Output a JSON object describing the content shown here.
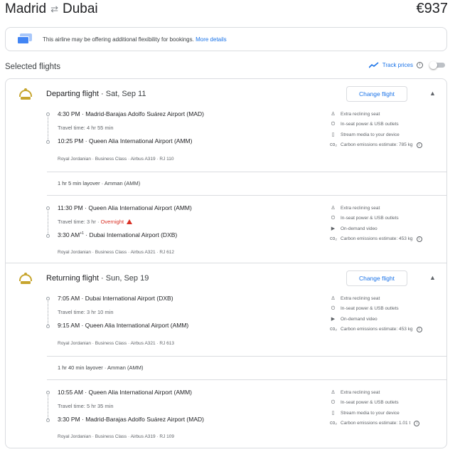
{
  "header": {
    "origin": "Madrid",
    "destination": "Dubai",
    "swap_icon": "swap-arrows-icon",
    "price": "€937"
  },
  "notice": {
    "text": "This airline may be offering additional flexibility for bookings.",
    "link": "More details"
  },
  "selected": {
    "title": "Selected flights",
    "track_label": "Track prices",
    "track_enabled": false
  },
  "departing": {
    "title": "Departing flight",
    "date": "Sat, Sep 11",
    "change_label": "Change flight",
    "seg1": {
      "dep_time": "4:30 PM",
      "dep_airport": "Madrid-Barajas Adolfo Suárez Airport (MAD)",
      "travel_time": "Travel time: 4 hr 55 min",
      "arr_time": "10:25 PM",
      "arr_airport": "Queen Alia International Airport (AMM)",
      "meta": "Royal Jordanian · Business Class · Airbus A319 · RJ 110",
      "amenities": [
        "Extra reclining seat",
        "In-seat power & USB outlets",
        "Stream media to your device",
        "Carbon emissions estimate: 785 kg"
      ]
    },
    "layover": "1 hr 5 min layover · Amman (AMM)",
    "seg2": {
      "dep_time": "11:30 PM",
      "dep_airport": "Queen Alia International Airport (AMM)",
      "travel_time": "Travel time: 3 hr",
      "overnight": "Overnight",
      "arr_time": "3:30 AM",
      "arr_sup": "+1",
      "arr_airport": "Dubai International Airport (DXB)",
      "meta": "Royal Jordanian · Business Class · Airbus A321 · RJ 612",
      "amenities": [
        "Extra reclining seat",
        "In-seat power & USB outlets",
        "On-demand video",
        "Carbon emissions estimate: 453 kg"
      ]
    }
  },
  "returning": {
    "title": "Returning flight",
    "date": "Sun, Sep 19",
    "change_label": "Change flight",
    "seg1": {
      "dep_time": "7:05 AM",
      "dep_airport": "Dubai International Airport (DXB)",
      "travel_time": "Travel time: 3 hr 10 min",
      "arr_time": "9:15 AM",
      "arr_airport": "Queen Alia International Airport (AMM)",
      "meta": "Royal Jordanian · Business Class · Airbus A321 · RJ 613",
      "amenities": [
        "Extra reclining seat",
        "In-seat power & USB outlets",
        "On-demand video",
        "Carbon emissions estimate: 453 kg"
      ]
    },
    "layover": "1 hr 40 min layover · Amman (AMM)",
    "seg2": {
      "dep_time": "10:55 AM",
      "dep_airport": "Queen Alia International Airport (AMM)",
      "travel_time": "Travel time: 5 hr 35 min",
      "arr_time": "3:30 PM",
      "arr_airport": "Madrid-Barajas Adolfo Suárez Airport (MAD)",
      "meta": "Royal Jordanian · Business Class · Airbus A319 · RJ 109",
      "amenities": [
        "Extra reclining seat",
        "In-seat power & USB outlets",
        "Stream media to your device",
        "Carbon emissions estimate: 1.01 t"
      ]
    }
  },
  "colors": {
    "link": "#1a73e8",
    "warning": "#d93025",
    "airline_logo": "#c7a52e",
    "border": "#dadce0"
  }
}
